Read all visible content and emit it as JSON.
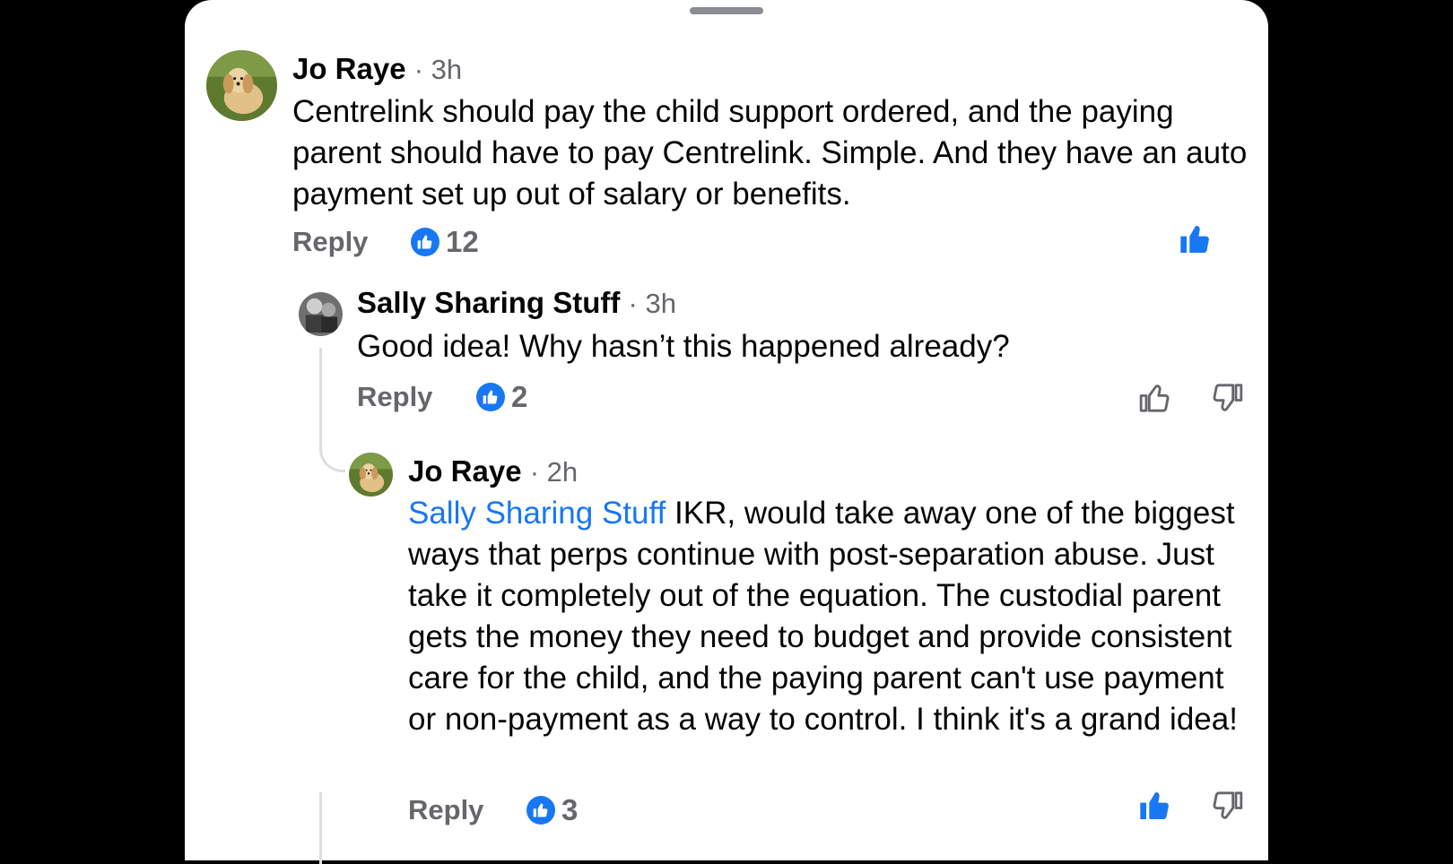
{
  "comments": [
    {
      "author": "Jo Raye",
      "time": "· 3h",
      "text": "Centrelink should pay the child support ordered, and the paying parent should have to pay Centrelink.  Simple.  And they have an auto payment set up out of salary or benefits.",
      "reply_label": "Reply",
      "like_count": "12",
      "liked": true
    },
    {
      "author": "Sally Sharing Stuff",
      "time": "· 3h",
      "text": "Good idea! Why hasn’t this happened already?",
      "reply_label": "Reply",
      "like_count": "2",
      "liked": false
    },
    {
      "author": "Jo Raye",
      "time": "· 2h",
      "mention": "Sally Sharing Stuff",
      "text": " IKR, would take away one of the biggest ways that perps continue with post-separation abuse.  Just take it completely out of the equation.  The custodial parent gets the money they need to budget and provide consistent care for the child, and the paying parent can't use payment or non-payment as a way to control.  I think it's a grand idea!",
      "reply_label": "Reply",
      "like_count": "3",
      "liked": true
    }
  ],
  "colors": {
    "accent": "#1877f2",
    "muted": "#65676b",
    "text": "#050505",
    "thread_line": "#dcdee2"
  },
  "icons": [
    "like-reaction-icon",
    "thumbs-up-icon",
    "thumbs-down-icon",
    "drag-handle"
  ]
}
